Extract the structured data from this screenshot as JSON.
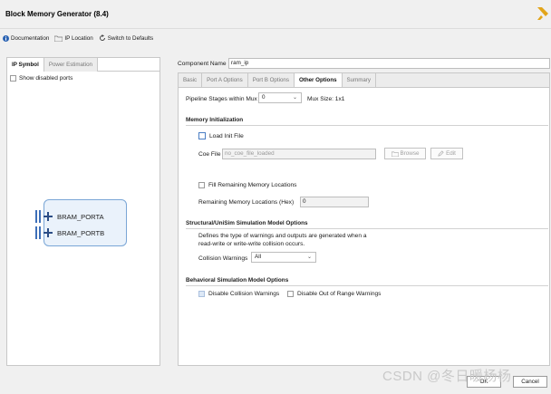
{
  "window": {
    "title": "Block Memory Generator (8.4)"
  },
  "toolbar": {
    "documentation": "Documentation",
    "ip_location": "IP Location",
    "switch_defaults": "Switch to Defaults"
  },
  "left_panel": {
    "tabs": [
      {
        "label": "IP Symbol",
        "active": true
      },
      {
        "label": "Power Estimation",
        "active": false
      }
    ],
    "show_disabled_ports": "Show disabled ports",
    "ports": [
      "BRAM_PORTA",
      "BRAM_PORTB"
    ]
  },
  "right_panel": {
    "component_name_label": "Component Name",
    "component_name_value": "ram_ip",
    "tabs": [
      {
        "label": "Basic",
        "active": false
      },
      {
        "label": "Port A Options",
        "active": false
      },
      {
        "label": "Port B Options",
        "active": false
      },
      {
        "label": "Other Options",
        "active": true
      },
      {
        "label": "Summary",
        "active": false
      }
    ],
    "pipeline_label": "Pipeline Stages within Mux",
    "pipeline_value": "0",
    "mux_size": "Mux Size: 1x1",
    "mem_init": {
      "heading": "Memory Initialization",
      "load_init_file": "Load Init File",
      "coe_label": "Coe File",
      "coe_value": "no_coe_file_loaded",
      "browse": "Browse",
      "edit": "Edit",
      "fill_remaining": "Fill Remaining Memory Locations",
      "remaining_label": "Remaining Memory Locations (Hex)",
      "remaining_value": "0"
    },
    "sim": {
      "heading": "Structural/UniSim Simulation Model Options",
      "desc1": "Defines the type of warnings and outputs are generated when a",
      "desc2": "read-write or write-write collision occurs.",
      "collision_label": "Collision Warnings",
      "collision_value": "All"
    },
    "behavioral": {
      "heading": "Behavioral Simulation Model Options",
      "disable_collision": "Disable Collision Warnings",
      "disable_oor": "Disable Out of Range Warnings"
    }
  },
  "footer": {
    "ok": "OK",
    "cancel": "Cancel"
  },
  "watermark": "CSDN @冬日暖杨杨",
  "colors": {
    "accent": "#3d6fb8",
    "logo": "#e2a51b"
  }
}
